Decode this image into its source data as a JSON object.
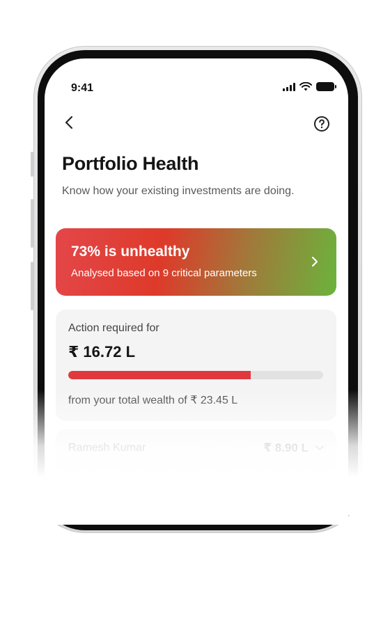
{
  "status_bar": {
    "time": "9:41",
    "icons": [
      "signal-icon",
      "wifi-icon",
      "battery-icon"
    ]
  },
  "header": {
    "back_icon": "chevron-left-icon",
    "help_icon": "help-circle-icon"
  },
  "page": {
    "title": "Portfolio Health",
    "subtitle": "Know how your existing investments are doing."
  },
  "health_card": {
    "title": "73% is unhealthy",
    "subtitle": "Analysed based on 9 critical parameters",
    "icon": "chevron-right-icon",
    "colors": {
      "start": "#e4474a",
      "mid": "#de3a2a",
      "end": "#6bb33c"
    }
  },
  "action_card": {
    "label": "Action required for",
    "amount": "₹ 16.72 L",
    "progress_fraction": 0.715,
    "total_text": "from your total wealth of ₹ 23.45 L",
    "colors": {
      "fill": "#e0393e",
      "track": "#e2e2e2"
    }
  },
  "member": {
    "name": "Ramesh Kumar",
    "amount": "₹ 8.90 L",
    "icon": "chevron-down-icon"
  }
}
